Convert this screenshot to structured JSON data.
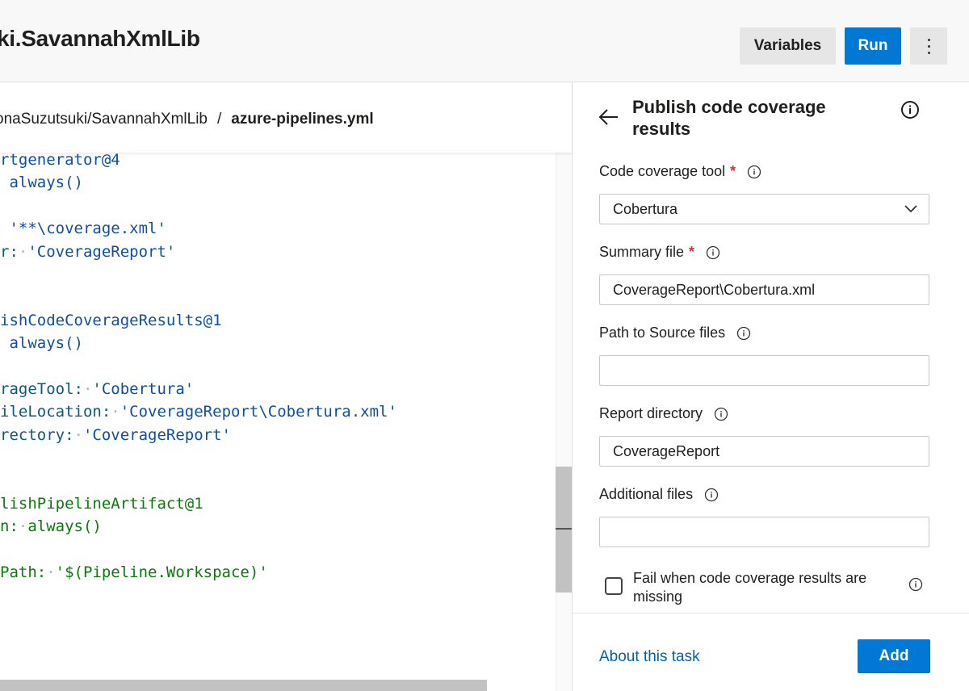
{
  "header": {
    "title": "ki.SavannahXmlLib",
    "variables_label": "Variables",
    "run_label": "Run"
  },
  "breadcrumb": {
    "repo": "onaSuzutsuki/SavannahXmlLib",
    "separator": "/",
    "file": "azure-pipelines.yml"
  },
  "code_lines": [
    [
      {
        "t": "rtgenerator@4",
        "c": "c-blue"
      }
    ],
    [
      {
        "t": " ",
        "c": "c-dot"
      },
      {
        "t": "always()",
        "c": "c-blue"
      }
    ],
    [],
    [
      {
        "t": " ",
        "c": "c-dot"
      },
      {
        "t": "'**\\coverage.xml'",
        "c": "c-blue"
      }
    ],
    [
      {
        "t": "r:",
        "c": "c-teal"
      },
      {
        "t": "·",
        "c": "c-dot"
      },
      {
        "t": "'CoverageReport'",
        "c": "c-blue"
      }
    ],
    [],
    [],
    [
      {
        "t": "ishCodeCoverageResults@1",
        "c": "c-blue"
      }
    ],
    [
      {
        "t": " ",
        "c": "c-dot"
      },
      {
        "t": "always()",
        "c": "c-blue"
      }
    ],
    [],
    [
      {
        "t": "rageTool:",
        "c": "c-teal"
      },
      {
        "t": "·",
        "c": "c-dot"
      },
      {
        "t": "'Cobertura'",
        "c": "c-blue"
      }
    ],
    [
      {
        "t": "ileLocation:",
        "c": "c-teal"
      },
      {
        "t": "·",
        "c": "c-dot"
      },
      {
        "t": "'CoverageReport\\Cobertura.xml'",
        "c": "c-blue"
      }
    ],
    [
      {
        "t": "rectory:",
        "c": "c-teal"
      },
      {
        "t": "·",
        "c": "c-dot"
      },
      {
        "t": "'CoverageReport'",
        "c": "c-blue"
      }
    ],
    [],
    [],
    [
      {
        "t": "lishPipelineArtifact@1",
        "c": "c-green"
      }
    ],
    [
      {
        "t": "n:",
        "c": "c-green"
      },
      {
        "t": "·",
        "c": "c-dot"
      },
      {
        "t": "always()",
        "c": "c-green"
      }
    ],
    [],
    [
      {
        "t": "Path:",
        "c": "c-green"
      },
      {
        "t": "·",
        "c": "c-dot"
      },
      {
        "t": "'$(Pipeline.Workspace)'",
        "c": "c-green"
      }
    ]
  ],
  "panel": {
    "title": "Publish code coverage results",
    "fields": {
      "coverage_tool": {
        "label": "Code coverage tool",
        "required": "*",
        "value": "Cobertura"
      },
      "summary_file": {
        "label": "Summary file",
        "required": "*",
        "value": "CoverageReport\\Cobertura.xml"
      },
      "source_path": {
        "label": "Path to Source files",
        "value": ""
      },
      "report_dir": {
        "label": "Report directory",
        "value": "CoverageReport"
      },
      "additional_files": {
        "label": "Additional files",
        "value": ""
      }
    },
    "fail_checkbox": {
      "label": "Fail when code coverage results are missing",
      "checked": false
    },
    "about_link": "About this task",
    "add_label": "Add"
  },
  "colors": {
    "accent": "#0078d4",
    "required": "#d13438",
    "link": "#0062b1"
  }
}
